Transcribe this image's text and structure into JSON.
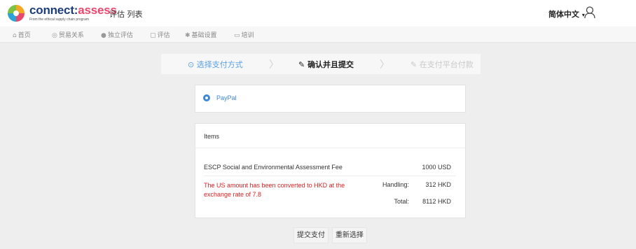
{
  "header": {
    "brand_part1": "connect:",
    "brand_part2": "assess",
    "tagline": "From the ethical supply chain program",
    "app_title": "评估 列表",
    "language": "简体中文",
    "language_caret": "▾"
  },
  "nav": {
    "items": [
      {
        "label": "首页",
        "icon": "home-icon"
      },
      {
        "label": "贸易关系",
        "icon": "eye-icon"
      },
      {
        "label": "独立评估",
        "icon": "people-icon"
      },
      {
        "label": "评估",
        "icon": "doc-icon"
      },
      {
        "label": "基础设置",
        "icon": "gear-icon"
      },
      {
        "label": "培训",
        "icon": "monitor-icon"
      }
    ]
  },
  "steps": {
    "step1": "选择支付方式",
    "step2": "确认并且提交",
    "step3": "在支付平台付款"
  },
  "payment": {
    "method": "PayPal"
  },
  "items": {
    "header": "Items",
    "fee_name": "ESCP Social and Environmental Assessment Fee",
    "fee_value": "1000 USD",
    "note": "The US amount has been converted to HKD at the exchange rate of 7.8",
    "handling_label": "Handling:",
    "handling_value": "312 HKD",
    "total_label": "Total:",
    "total_value": "8112 HKD"
  },
  "buttons": {
    "submit": "提交支付",
    "reselect": "重新选择"
  },
  "colors": {
    "brand_dark": "#1c3d7a",
    "brand_accent": "#e8476e",
    "active_step": "#5aa0e0",
    "paypal_blue": "#3a86d8",
    "warning_red": "#e02020"
  }
}
